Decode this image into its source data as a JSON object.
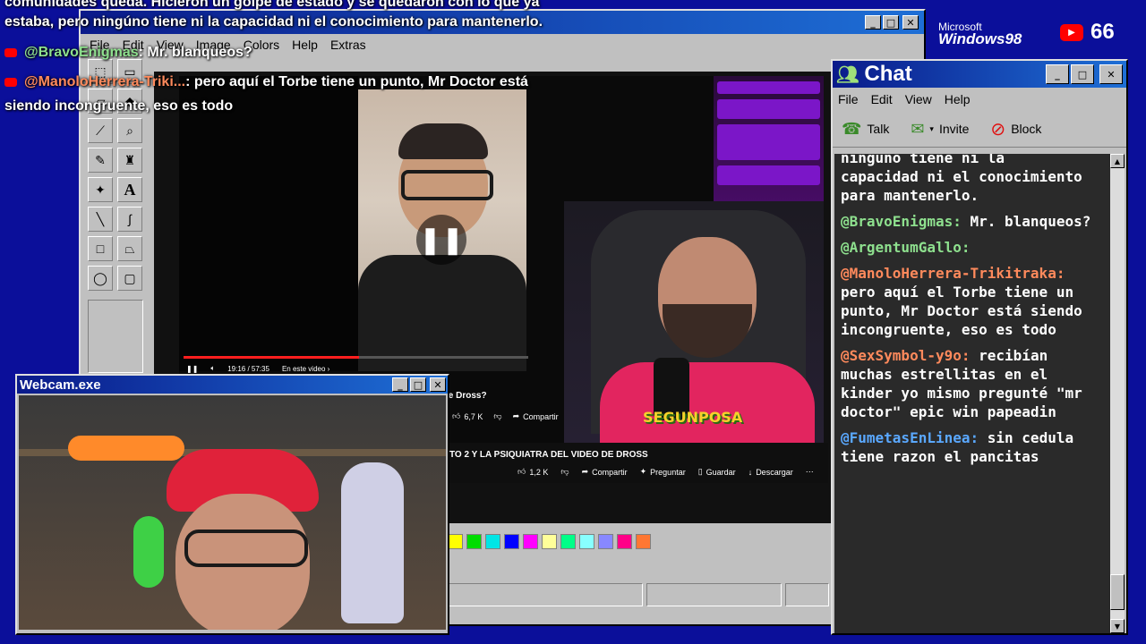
{
  "overlay": {
    "top_line1": "comunidades queda. Hicieron un golpe de estado y se quedaron con lo que ya",
    "top_line2_pre": "estaba, pero ",
    "top_line2_rest": "ningúno tiene ni la capacidad ni el conocimiento para mantenerlo.",
    "msg1_user": "@BravoEnigmas",
    "msg1_text": ": Mr. blanqueos?",
    "msg2_user": "@ManoloHerrera-Triki...",
    "msg2_text": ": pero aquí el Torbe tiene un punto, Mr Doctor está",
    "msg2_text2": "siendo incongruente, eso es todo"
  },
  "paint": {
    "menu": [
      "File",
      "Edit",
      "View",
      "Image",
      "Colors",
      "Help",
      "Extras"
    ],
    "palette": [
      "#ffff00",
      "#00dd00",
      "#00e5e5",
      "#0000ff",
      "#ff00ff",
      "#ffff99",
      "#00ff88",
      "#88ffff",
      "#8888ff",
      "#ff0088",
      "#ff7733"
    ]
  },
  "windows98_logo": {
    "brand": "Microsoft",
    "name": "Windows98"
  },
  "youtube_badge": {
    "count": "66"
  },
  "video": {
    "time": "19:16 / 57:35",
    "chapter": "En este video ›",
    "inner_title": "le Dross?",
    "inner_likes": "6,7 K",
    "inner_share": "Compartir",
    "main_title": "TO 2 Y LA PSIQUIATRA DEL VIDEO DE DROSS",
    "likes": "1,2 K",
    "share": "Compartir",
    "ask": "Preguntar",
    "save": "Guardar",
    "download": "Descargar",
    "streamer_logo": "SEGUNPOSA"
  },
  "webcam": {
    "title": "Webcam.exe"
  },
  "chat": {
    "title": "Chat",
    "menu": [
      "File",
      "Edit",
      "View",
      "Help"
    ],
    "toolbar": {
      "talk": "Talk",
      "invite": "Invite",
      "block": "Block"
    },
    "partial_top": "ninguno tiene ni la",
    "messages": [
      {
        "user": "",
        "text": "capacidad ni el conocimiento para mantenerlo.",
        "color": "#ffffff"
      },
      {
        "user": "@BravoEnigmas:",
        "text": "Mr. blanqueos?",
        "color": "#8ee08e"
      },
      {
        "user": "@ArgentumGallo:",
        "text": "",
        "color": "#8ee08e"
      },
      {
        "user": "@ManoloHerrera-Trikitraka:",
        "text": "pero aquí el Torbe tiene un punto, Mr Doctor está siendo incongruente, eso es todo",
        "color": "#ff8a5c"
      },
      {
        "user": "@SexSymbol-y9o:",
        "text": "recibían muchas estrellitas en el kinder yo mismo pregunté \"mr doctor\" epic win papeadin",
        "color": "#ff8a5c"
      },
      {
        "user": "@FumetasEnLinea:",
        "text": "sin cedula tiene razon el pancitas",
        "color": "#5aa8ff"
      }
    ]
  }
}
